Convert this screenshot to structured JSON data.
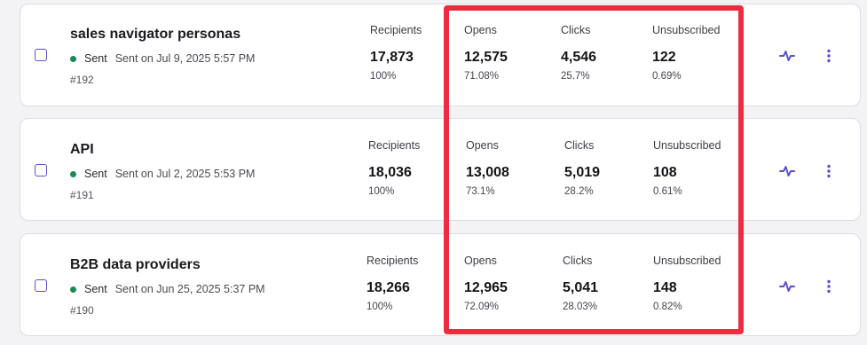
{
  "campaigns": [
    {
      "title": "sales navigator personas",
      "status": "Sent",
      "sent_date": "Sent on Jul 9, 2025 5:57 PM",
      "id": "#192",
      "recipients": {
        "label": "Recipients",
        "value": "17,873",
        "pct": "100%"
      },
      "opens": {
        "label": "Opens",
        "value": "12,575",
        "pct": "71.08%"
      },
      "clicks": {
        "label": "Clicks",
        "value": "4,546",
        "pct": "25.7%"
      },
      "unsubscribed": {
        "label": "Unsubscribed",
        "value": "122",
        "pct": "0.69%"
      }
    },
    {
      "title": "API",
      "status": "Sent",
      "sent_date": "Sent on Jul 2, 2025 5:53 PM",
      "id": "#191",
      "recipients": {
        "label": "Recipients",
        "value": "18,036",
        "pct": "100%"
      },
      "opens": {
        "label": "Opens",
        "value": "13,008",
        "pct": "73.1%"
      },
      "clicks": {
        "label": "Clicks",
        "value": "5,019",
        "pct": "28.2%"
      },
      "unsubscribed": {
        "label": "Unsubscribed",
        "value": "108",
        "pct": "0.61%"
      }
    },
    {
      "title": "B2B data providers",
      "status": "Sent",
      "sent_date": "Sent on Jun 25, 2025 5:37 PM",
      "id": "#190",
      "recipients": {
        "label": "Recipients",
        "value": "18,266",
        "pct": "100%"
      },
      "opens": {
        "label": "Opens",
        "value": "12,965",
        "pct": "72.09%"
      },
      "clicks": {
        "label": "Clicks",
        "value": "5,041",
        "pct": "28.03%"
      },
      "unsubscribed": {
        "label": "Unsubscribed",
        "value": "148",
        "pct": "0.82%"
      }
    }
  ],
  "colors": {
    "accent": "#5a4fcf",
    "sent_dot": "#1a8a5a",
    "highlight": "#ef2b3f"
  },
  "icons": {
    "activity": "activity-icon",
    "menu": "more-vertical-icon"
  }
}
